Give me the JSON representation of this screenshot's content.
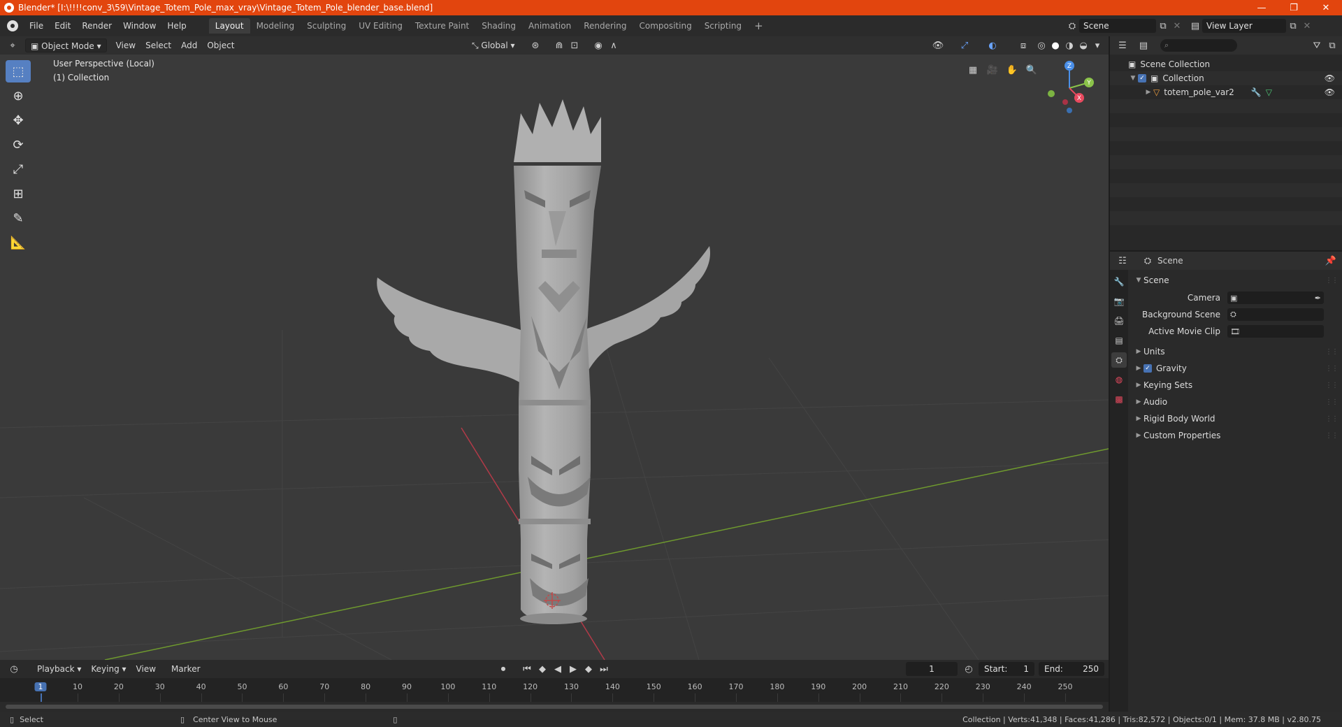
{
  "window": {
    "title": "Blender* [I:\\!!!!conv_3\\59\\Vintage_Totem_Pole_max_vray\\Vintage_Totem_Pole_blender_base.blend]",
    "minimize": "—",
    "restore": "❐",
    "close": "✕"
  },
  "menu": [
    "File",
    "Edit",
    "Render",
    "Window",
    "Help"
  ],
  "workspaces": [
    "Layout",
    "Modeling",
    "Sculpting",
    "UV Editing",
    "Texture Paint",
    "Shading",
    "Animation",
    "Rendering",
    "Compositing",
    "Scripting"
  ],
  "active_workspace": "Layout",
  "add_workspace": "+",
  "scene_field": "Scene",
  "view_layer_field": "View Layer",
  "viewport": {
    "mode": "Object Mode",
    "menus": [
      "View",
      "Select",
      "Add",
      "Object"
    ],
    "transform_orientation": "Global",
    "overlay_title": "User Perspective (Local)",
    "overlay_collection": "(1) Collection",
    "gizmo_axes": [
      "Z",
      "Y",
      "X"
    ]
  },
  "timeline": {
    "menus": [
      "Playback",
      "Keying",
      "View",
      "Marker"
    ],
    "current_frame": "1",
    "start_label": "Start:",
    "start_value": "1",
    "end_label": "End:",
    "end_value": "250",
    "ticks": [
      "1",
      "10",
      "20",
      "30",
      "40",
      "50",
      "60",
      "70",
      "80",
      "90",
      "100",
      "110",
      "120",
      "130",
      "140",
      "150",
      "160",
      "170",
      "180",
      "190",
      "200",
      "210",
      "220",
      "230",
      "240",
      "250"
    ]
  },
  "status": {
    "select": "Select",
    "center_view": "Center View to Mouse",
    "stats": "Collection | Verts:41,348 | Faces:41,286 | Tris:82,572 | Objects:0/1 | Mem: 37.8 MB | v2.80.75"
  },
  "outliner": {
    "scene_collection": "Scene Collection",
    "collection": "Collection",
    "object": "totem_pole_var2"
  },
  "properties": {
    "header": "Scene",
    "section_scene": "Scene",
    "camera_label": "Camera",
    "background_scene_label": "Background Scene",
    "active_movie_clip_label": "Active Movie Clip",
    "sections": [
      "Units",
      "Gravity",
      "Keying Sets",
      "Audio",
      "Rigid Body World",
      "Custom Properties"
    ]
  },
  "colors": {
    "title_bar": "#e2450e",
    "active_tool": "#5680c2",
    "axis_x": "#e84a5f",
    "axis_y": "#8bc34a",
    "axis_z": "#4a8fe8"
  }
}
